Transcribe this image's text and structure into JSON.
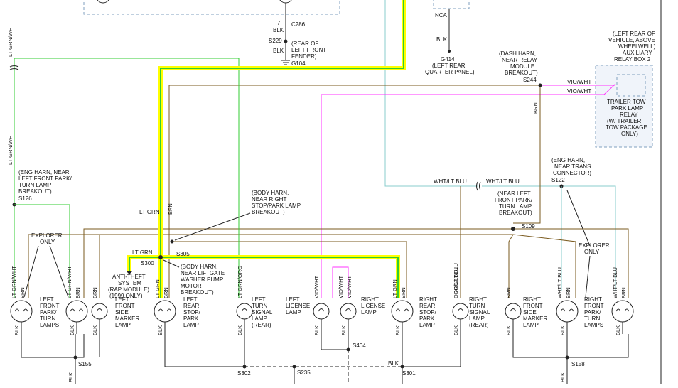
{
  "colors": {
    "lt_grn": "#33cc33",
    "brn": "#7a5a1e",
    "blk": "#222222",
    "vio": "#ff33ff",
    "wht_blu": "#88cccc",
    "highlight_yellow": "#ffff00",
    "highlight_green": "#33cc33",
    "dashed_box": "#7f9fbf"
  },
  "top": {
    "wire_7_blk": "7\nBLK",
    "c286": "C286",
    "s229": "S229",
    "blk1": "BLK",
    "g104_note": [
      "(REAR OF",
      "LEFT FRONT",
      "FENDER)"
    ],
    "g104": "G104",
    "nca": "NCA",
    "blk2": "BLK",
    "g414": "G414",
    "g414_note": [
      "(LEFT REAR",
      "QUARTER PANEL)"
    ]
  },
  "relay": {
    "note": [
      "(LEFT REAR OF",
      "VEHICLE, ABOVE",
      "WHEELWELL)",
      "AUXILIARY",
      "RELAY BOX 2"
    ],
    "name": [
      "TRAILER TOW",
      "PARK LAMP",
      "RELAY",
      "(W/ TRAILER",
      "TOW PACKAGE",
      "ONLY)"
    ],
    "wire1": "VIO/WHT",
    "wire2": "VIO/WHT"
  },
  "splices": {
    "s244_note": [
      "(DASH HARN,",
      "NEAR RELAY",
      "MODULE",
      "BREAKOUT)"
    ],
    "s244": "S244",
    "s126_note": [
      "(ENG HARN, NEAR",
      "LEFT FRONT PARK/",
      "TURN LAMP",
      "BREAKOUT)"
    ],
    "s126": "S126",
    "s305_note": [
      "(BODY HARN,",
      "NEAR RIGHT",
      "STOP/PARK LAMP",
      "BREAKOUT)"
    ],
    "s305": "S305",
    "s300": "S300",
    "s300_note": [
      "(BODY HARN,",
      "NEAR LIFTGATE",
      "WASHER PUMP",
      "MOTOR",
      "BREAKOUT)"
    ],
    "s122_note": [
      "(ENG HARN,",
      "NEAR TRANS",
      "CONNECTOR)"
    ],
    "s122": "S122",
    "s109_note": [
      "(NEAR LEFT",
      "FRONT PARK/",
      "TURN LAMP",
      "BREAKOUT)"
    ],
    "s109": "S109",
    "s155": "S155",
    "s302": "S302",
    "s235": "S235",
    "s404": "S404",
    "s301": "S301",
    "s158": "S158"
  },
  "wires": {
    "lt_grn_wht_a": "LT GRN/WHT",
    "lt_grn_wht_b": "LT GRN/WHT",
    "brn": "BRN",
    "lt_grn": "LT GRN",
    "wht_lt_blu_a": "WHT/LT BLU",
    "wht_lt_blu_b": "WHT/LT BLU",
    "lt_grn_left": "LT GRN",
    "blk": "BLK"
  },
  "notes": {
    "explorer_only_l": [
      "EXPLORER",
      "ONLY"
    ],
    "explorer_only_r": [
      "EXPLORER",
      "ONLY"
    ],
    "anti_theft": [
      "ANTI-THEFT",
      "SYSTEM",
      "(RAP MODULE)",
      "(1999 ONLY)"
    ]
  },
  "lamps": [
    {
      "id": "left-front-park-turn",
      "label": [
        "LEFT",
        "FRONT",
        "PARK/",
        "TURN",
        "LAMPS"
      ],
      "wires": [
        "LT GRN/WHT",
        "BRN"
      ],
      "ground": "BLK"
    },
    {
      "id": "left-front-park-turn-2",
      "label": [],
      "wires": [
        "LT GRN/WHT",
        "BRN"
      ],
      "ground": "BLK"
    },
    {
      "id": "left-front-side-marker",
      "label": [
        "LEFT",
        "FRONT",
        "SIDE",
        "MARKER",
        "LAMP"
      ],
      "wires": [
        "BRN"
      ],
      "ground": "BLK"
    },
    {
      "id": "left-rear-stop-park",
      "label": [
        "LEFT",
        "REAR",
        "STOP/",
        "PARK",
        "LAMP"
      ],
      "wires": [
        "LT GRN",
        "BRN"
      ],
      "ground": "BLK"
    },
    {
      "id": "left-turn-signal",
      "label": [
        "LEFT",
        "TURN",
        "SIGNAL",
        "LAMP",
        "(REAR)"
      ],
      "wires": [
        "LT GRN/ORG"
      ],
      "ground": "BLK"
    },
    {
      "id": "left-license",
      "label": [
        "LEFT",
        "LICENSE",
        "LAMP"
      ],
      "wires": [
        "VIO/WHT"
      ],
      "ground": "BLK"
    },
    {
      "id": "right-license",
      "label": [
        "RIGHT",
        "LICENSE",
        "LAMP"
      ],
      "wires": [
        "VIO/WHT",
        "VIO/WHT"
      ],
      "ground": "BLK"
    },
    {
      "id": "right-rear-stop-park",
      "label": [
        "RIGHT",
        "REAR",
        "STOP/",
        "PARK",
        "LAMP"
      ],
      "wires": [
        "LT GRN",
        "BRN"
      ],
      "ground": "BLK"
    },
    {
      "id": "right-turn-signal",
      "label": [
        "RIGHT",
        "TURN",
        "SIGNAL",
        "LAMP",
        "(REAR)"
      ],
      "wires": [
        "ORG/LT BLU"
      ],
      "ground": "BLK"
    },
    {
      "id": "right-front-side-marker",
      "label": [
        "RIGHT",
        "FRONT",
        "SIDE",
        "MARKER",
        "LAMP"
      ],
      "wires": [
        "BRN"
      ],
      "ground": "BLK"
    },
    {
      "id": "right-front-park-turn",
      "label": [
        "RIGHT",
        "FRONT",
        "PARK/",
        "TURN",
        "LAMPS"
      ],
      "wires": [
        "WHT/LT BLU",
        "BRN"
      ],
      "ground": "BLK"
    },
    {
      "id": "right-front-park-turn-2",
      "label": [],
      "wires": [
        "WHT/LT BLU",
        "BRN"
      ],
      "ground": "BLK"
    }
  ]
}
